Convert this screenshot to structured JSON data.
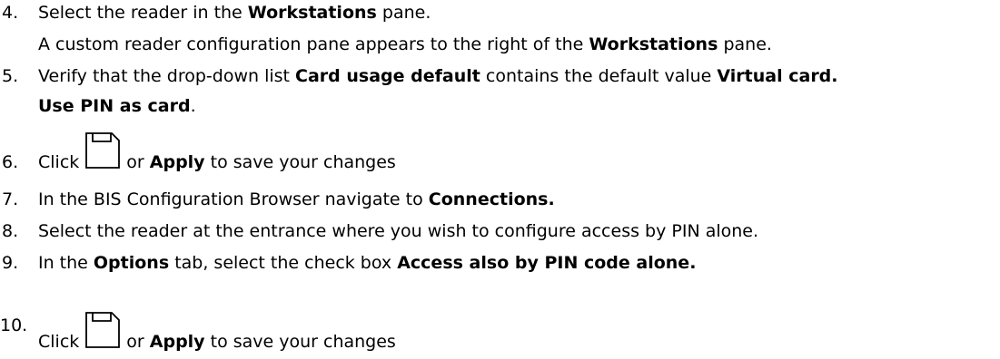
{
  "steps": [
    {
      "number": "4.",
      "pre": "Select the reader in the ",
      "bold1": "Workstations",
      "post": " pane.",
      "sub_pre": "A custom reader configuration pane appears to the right of the ",
      "sub_bold": "Workstations",
      "sub_post": " pane."
    },
    {
      "number": "5.",
      "pre": "Verify that the drop-down list ",
      "bold1": "Card usage default",
      "mid": " contains the default value ",
      "bold2": "Virtual card.",
      "line2_bold": "Use PIN as card",
      "line2_post": "."
    },
    {
      "number": "6.",
      "pre": "Click",
      "icon": "save-icon",
      "mid": "or ",
      "bold1": "Apply",
      "post": " to save your changes"
    },
    {
      "number": "7.",
      "pre": "In the BIS Configuration Browser navigate to ",
      "bold1": "Connections."
    },
    {
      "number": "8.",
      "pre": "Select the reader at the entrance where you wish to configure access by PIN alone."
    },
    {
      "number": "9.",
      "pre": "In the ",
      "bold1": "Options",
      "mid": " tab, select the check box ",
      "bold2": "Access also by PIN code alone."
    },
    {
      "number": "10.",
      "pre": "Click",
      "icon": "save-icon",
      "mid": "or ",
      "bold1": "Apply",
      "post": " to save your changes"
    }
  ]
}
